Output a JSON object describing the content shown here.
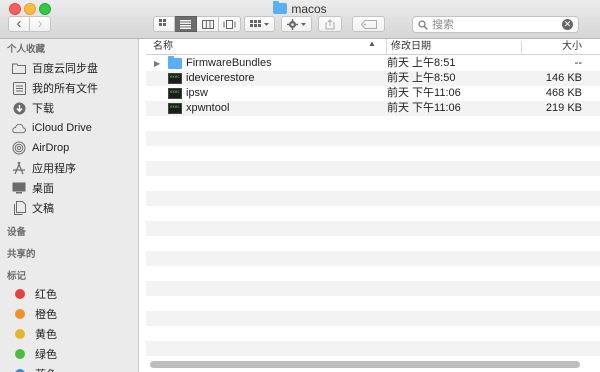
{
  "window": {
    "title": "macos"
  },
  "toolbar": {
    "back_glyph": "‹",
    "forward_glyph": "›",
    "search_placeholder": "搜索"
  },
  "sidebar": {
    "favorites_header": "个人收藏",
    "favorites": [
      {
        "label": "百度云同步盘",
        "icon": "folder-icon"
      },
      {
        "label": "我的所有文件",
        "icon": "all-files-icon"
      },
      {
        "label": "下载",
        "icon": "downloads-icon"
      },
      {
        "label": "iCloud Drive",
        "icon": "cloud-icon"
      },
      {
        "label": "AirDrop",
        "icon": "airdrop-icon"
      },
      {
        "label": "应用程序",
        "icon": "applications-icon"
      },
      {
        "label": "桌面",
        "icon": "desktop-icon"
      },
      {
        "label": "文稿",
        "icon": "documents-icon"
      }
    ],
    "devices_header": "设备",
    "shared_header": "共享的",
    "tags_header": "标记",
    "tags": [
      {
        "label": "红色",
        "color": "#e6423a"
      },
      {
        "label": "橙色",
        "color": "#f0902a"
      },
      {
        "label": "黄色",
        "color": "#e5b62a"
      },
      {
        "label": "绿色",
        "color": "#4cbc41"
      },
      {
        "label": "蓝色",
        "color": "#3b86e8"
      }
    ]
  },
  "list": {
    "columns": {
      "name": "名称",
      "date": "修改日期",
      "size": "大小"
    },
    "rows": [
      {
        "name": "FirmwareBundles",
        "date": "前天 上午8:51",
        "size": "--",
        "kind": "folder"
      },
      {
        "name": "idevicerestore",
        "date": "前天 上午8:50",
        "size": "146 KB",
        "kind": "exec"
      },
      {
        "name": "ipsw",
        "date": "前天 下午11:06",
        "size": "468 KB",
        "kind": "exec"
      },
      {
        "name": "xpwntool",
        "date": "前天 下午11:06",
        "size": "219 KB",
        "kind": "exec"
      }
    ]
  }
}
